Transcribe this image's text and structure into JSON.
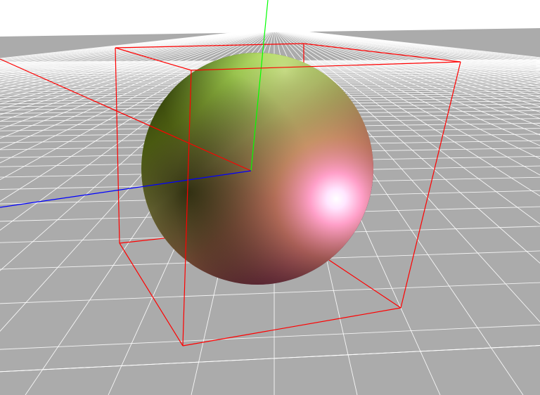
{
  "scene": {
    "background_color": "#ffffff",
    "floor": {
      "color": "#ababab",
      "grid_line_color": "#ffffff"
    },
    "sphere": {
      "shading": "normal-mapped",
      "colors": [
        "#ffd9ff",
        "#ff9fb0",
        "#f2f08a",
        "#b6ef6d",
        "#6f8a1c",
        "#2a2d04",
        "#6e2a2a",
        "#3a0722"
      ]
    },
    "bounding_box": {
      "color": "#ff0000",
      "style": "wireframe"
    },
    "axes": {
      "x": {
        "color": "#ff0000"
      },
      "y": {
        "color": "#00ff00"
      },
      "z": {
        "color": "#0000ff"
      }
    }
  }
}
